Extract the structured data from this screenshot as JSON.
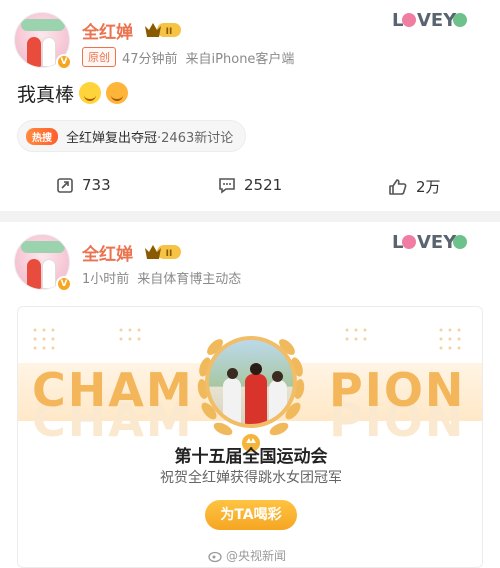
{
  "post1": {
    "username": "全红婵",
    "level_badge": "II",
    "original_tag": "原创",
    "time": "47分钟前",
    "source": "来自iPhone客户端",
    "watermark_logo": "LOVEYOU",
    "text": "我真棒",
    "emojis": [
      "smirk-emoji",
      "grin-emoji"
    ],
    "topic": {
      "badge": "热搜",
      "name": "全红婵复出夺冠",
      "count": "·2463新讨论"
    },
    "actions": {
      "reposts": "733",
      "comments": "2521",
      "likes": "2万"
    }
  },
  "post2": {
    "username": "全红婵",
    "level_badge": "II",
    "time": "1小时前",
    "source": "来自体育博主动态",
    "watermark_logo": "LOVEYOU",
    "card": {
      "banner_left": "CHAM",
      "banner_right": "PION",
      "title": "第十五届全国运动会",
      "subtitle": "祝贺全红婵获得跳水女团冠军",
      "button": "为TA喝彩"
    }
  },
  "footer": {
    "watermark": "@央视新闻"
  },
  "colors": {
    "brand_orange": "#eb7350",
    "gold": "#f3b65a",
    "button": "#f5a623"
  }
}
